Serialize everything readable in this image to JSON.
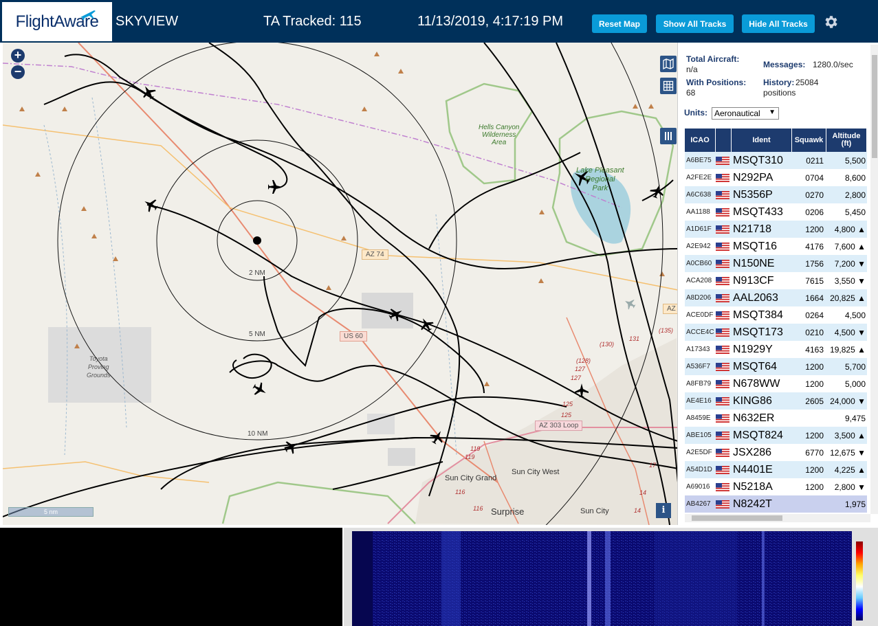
{
  "header": {
    "brand": "FlightAware",
    "app_title": "SKYVIEW",
    "tracked": "TA Tracked: 115",
    "datetime": "11/13/2019, 4:17:19 PM",
    "buttons": {
      "reset": "Reset Map",
      "show_all": "Show All Tracks",
      "hide_all": "Hide All Tracks"
    },
    "accent": "#0a9bd8",
    "bg": "#00305a"
  },
  "map": {
    "zoom_in": "+",
    "zoom_out": "−",
    "scale": "5 nm",
    "info": "i",
    "range_labels": [
      "2 NM",
      "5 NM",
      "10 NM"
    ],
    "place_labels": {
      "hells_canyon": [
        "Hells Canyon",
        "Wilderness",
        "Area"
      ],
      "lake_pleasant": [
        "Lake Pleasant",
        "Regional",
        "Park"
      ],
      "toyota": [
        "Toyota",
        "Proving",
        "Grounds"
      ],
      "sun_city_grand": "Sun City Grand",
      "sun_city_west": "Sun City West",
      "surprise": "Surprise",
      "sun_city": "Sun City"
    },
    "road_labels": {
      "az74": "AZ 74",
      "us60": "US 60",
      "az303": "AZ 303 Loop",
      "az": "AZ"
    },
    "route_numbers": [
      "(130)",
      "131",
      "(128)",
      "127",
      "127",
      "125",
      "125",
      "119",
      "119",
      "116",
      "116",
      "(135)",
      "17",
      "14",
      "14"
    ]
  },
  "sidebar": {
    "total_aircraft_label": "Total Aircraft:",
    "total_aircraft_value": "n/a",
    "messages_label": "Messages:",
    "messages_value": "1280.0/sec",
    "with_positions_label": "With Positions:",
    "with_positions_value": "68",
    "history_label": "History:",
    "history_value": "25084 positions",
    "units_label": "Units:",
    "units_value": "Aeronautical",
    "columns": [
      "ICAO",
      "",
      "Ident",
      "Squawk",
      "Altitude (ft)"
    ],
    "rows": [
      {
        "icao": "A6BE75",
        "ident": "MSQT310",
        "squawk": "0211",
        "alt": "5,500"
      },
      {
        "icao": "A2FE2E",
        "ident": "N292PA",
        "squawk": "0704",
        "alt": "8,600"
      },
      {
        "icao": "A6C638",
        "ident": "N5356P",
        "squawk": "0270",
        "alt": "2,800"
      },
      {
        "icao": "AA1188",
        "ident": "MSQT433",
        "squawk": "0206",
        "alt": "5,450"
      },
      {
        "icao": "A1D61F",
        "ident": "N21718",
        "squawk": "1200",
        "alt": "4,800 ▲"
      },
      {
        "icao": "A2E942",
        "ident": "MSQT16",
        "squawk": "4176",
        "alt": "7,600 ▲"
      },
      {
        "icao": "A0CB60",
        "ident": "N150NE",
        "squawk": "1756",
        "alt": "7,200 ▼"
      },
      {
        "icao": "ACA208",
        "ident": "N913CF",
        "squawk": "7615",
        "alt": "3,550 ▼"
      },
      {
        "icao": "A8D206",
        "ident": "AAL2063",
        "squawk": "1664",
        "alt": "20,825 ▲"
      },
      {
        "icao": "ACE0DF",
        "ident": "MSQT384",
        "squawk": "0264",
        "alt": "4,500"
      },
      {
        "icao": "ACCE4C",
        "ident": "MSQT173",
        "squawk": "0210",
        "alt": "4,500 ▼"
      },
      {
        "icao": "A17343",
        "ident": "N1929Y",
        "squawk": "4163",
        "alt": "19,825 ▲"
      },
      {
        "icao": "A536F7",
        "ident": "MSQT64",
        "squawk": "1200",
        "alt": "5,700"
      },
      {
        "icao": "A8FB79",
        "ident": "N678WW",
        "squawk": "1200",
        "alt": "5,000"
      },
      {
        "icao": "AE4E16",
        "ident": "KING86",
        "squawk": "2605",
        "alt": "24,000 ▼"
      },
      {
        "icao": "A8459E",
        "ident": "N632ER",
        "squawk": "",
        "alt": "9,475"
      },
      {
        "icao": "ABE105",
        "ident": "MSQT824",
        "squawk": "1200",
        "alt": "3,500 ▲"
      },
      {
        "icao": "A2E5DF",
        "ident": "JSX286",
        "squawk": "6770",
        "alt": "12,675 ▼"
      },
      {
        "icao": "A54D1D",
        "ident": "N4401E",
        "squawk": "1200",
        "alt": "4,225 ▲"
      },
      {
        "icao": "A69016",
        "ident": "N5218A",
        "squawk": "1200",
        "alt": "2,800 ▼"
      },
      {
        "icao": "AB4267",
        "ident": "N8242T",
        "squawk": "",
        "alt": "1,975"
      }
    ],
    "selected_row_color": "#c9d0ee",
    "header_color": "#1d3b6e"
  }
}
